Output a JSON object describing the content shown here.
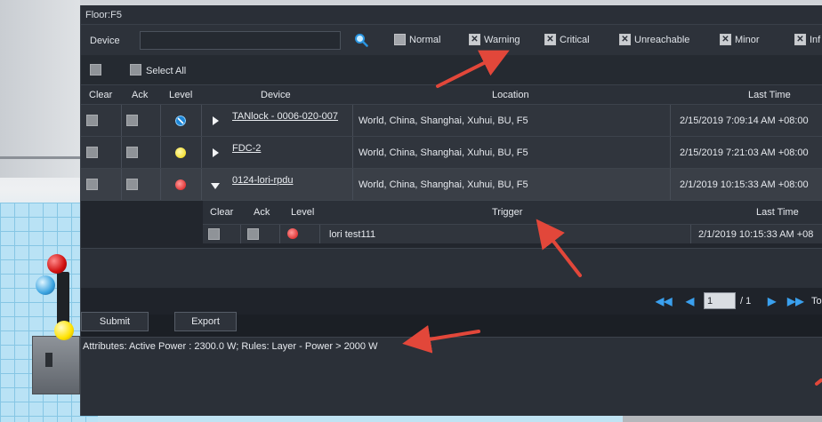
{
  "window": {
    "title": "Floor:F5"
  },
  "filter": {
    "device_label": "Device",
    "device_value": "",
    "device_placeholder": "",
    "states": [
      {
        "label": "Normal",
        "checked": false
      },
      {
        "label": "Warning",
        "checked": true
      },
      {
        "label": "Critical",
        "checked": true
      },
      {
        "label": "Unreachable",
        "checked": true
      },
      {
        "label": "Minor",
        "checked": true
      },
      {
        "label": "Inf",
        "checked": true
      }
    ]
  },
  "select_all": {
    "label": "Select All"
  },
  "alarms": {
    "columns": [
      "Clear",
      "Ack",
      "Level",
      "Device",
      "Location",
      "Last Time"
    ],
    "rows": [
      {
        "device": "TANlock - 0006-020-007",
        "location": "World, China, Shanghai, Xuhui, BU, F5",
        "last_time": "2/15/2019 7:09:14 AM +08:00",
        "level": "blue",
        "expanded": false
      },
      {
        "device": "FDC-2",
        "location": "World, China, Shanghai, Xuhui, BU, F5",
        "last_time": "2/15/2019 7:21:03 AM +08:00",
        "level": "yellow",
        "expanded": false
      },
      {
        "device": "0124-lori-rpdu",
        "location": "World, China, Shanghai, Xuhui, BU, F5",
        "last_time": "2/1/2019 10:15:33 AM +08:00",
        "level": "red",
        "expanded": true
      }
    ]
  },
  "sub_table": {
    "columns": [
      "Clear",
      "Ack",
      "Level",
      "Trigger",
      "Last Time"
    ],
    "rows": [
      {
        "trigger": "lori test111",
        "last_time": "2/1/2019 10:15:33 AM +08",
        "level": "red"
      }
    ]
  },
  "pager": {
    "current": "1",
    "total": "/ 1",
    "to_label": "To"
  },
  "buttons": {
    "submit": "Submit",
    "export": "Export"
  },
  "attributes": {
    "text": "Attributes: Active Power : 2300.0 W; Rules: Layer - Power > 2000 W"
  },
  "colors": {
    "accent": "#3aa0ee",
    "panel": "#1b1f25",
    "annotation": "#e2473a"
  }
}
